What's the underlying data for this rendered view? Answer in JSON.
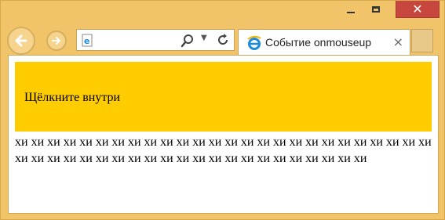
{
  "window": {
    "controls": {
      "minimize": "—",
      "maximize": "☐",
      "close": "✕"
    }
  },
  "toolbar": {
    "back_icon": "back-arrow-icon",
    "forward_icon": "forward-arrow-icon",
    "address_value": "",
    "search_icon": "search-icon",
    "dropdown_icon": "chevron-down-icon",
    "refresh_icon": "refresh-icon"
  },
  "tab": {
    "title": "Событие onmouseup",
    "close": "×"
  },
  "page": {
    "box_text": "Щёлкните внутри",
    "paragraph": "хи хи хи хи хи хи хи хи хи хи хи хи хи хи хи хи хи хи хи хи хи хи хи хи хи хи хи хи хи хи хи хи хи хи хи хи хи хи хи хи хи хи хи хи хи хи хи хи"
  },
  "colors": {
    "frame": "#f2c46a",
    "close_button": "#c7463d",
    "highlight_box": "#ffcc00",
    "ie_blue": "#1e8bd8"
  }
}
